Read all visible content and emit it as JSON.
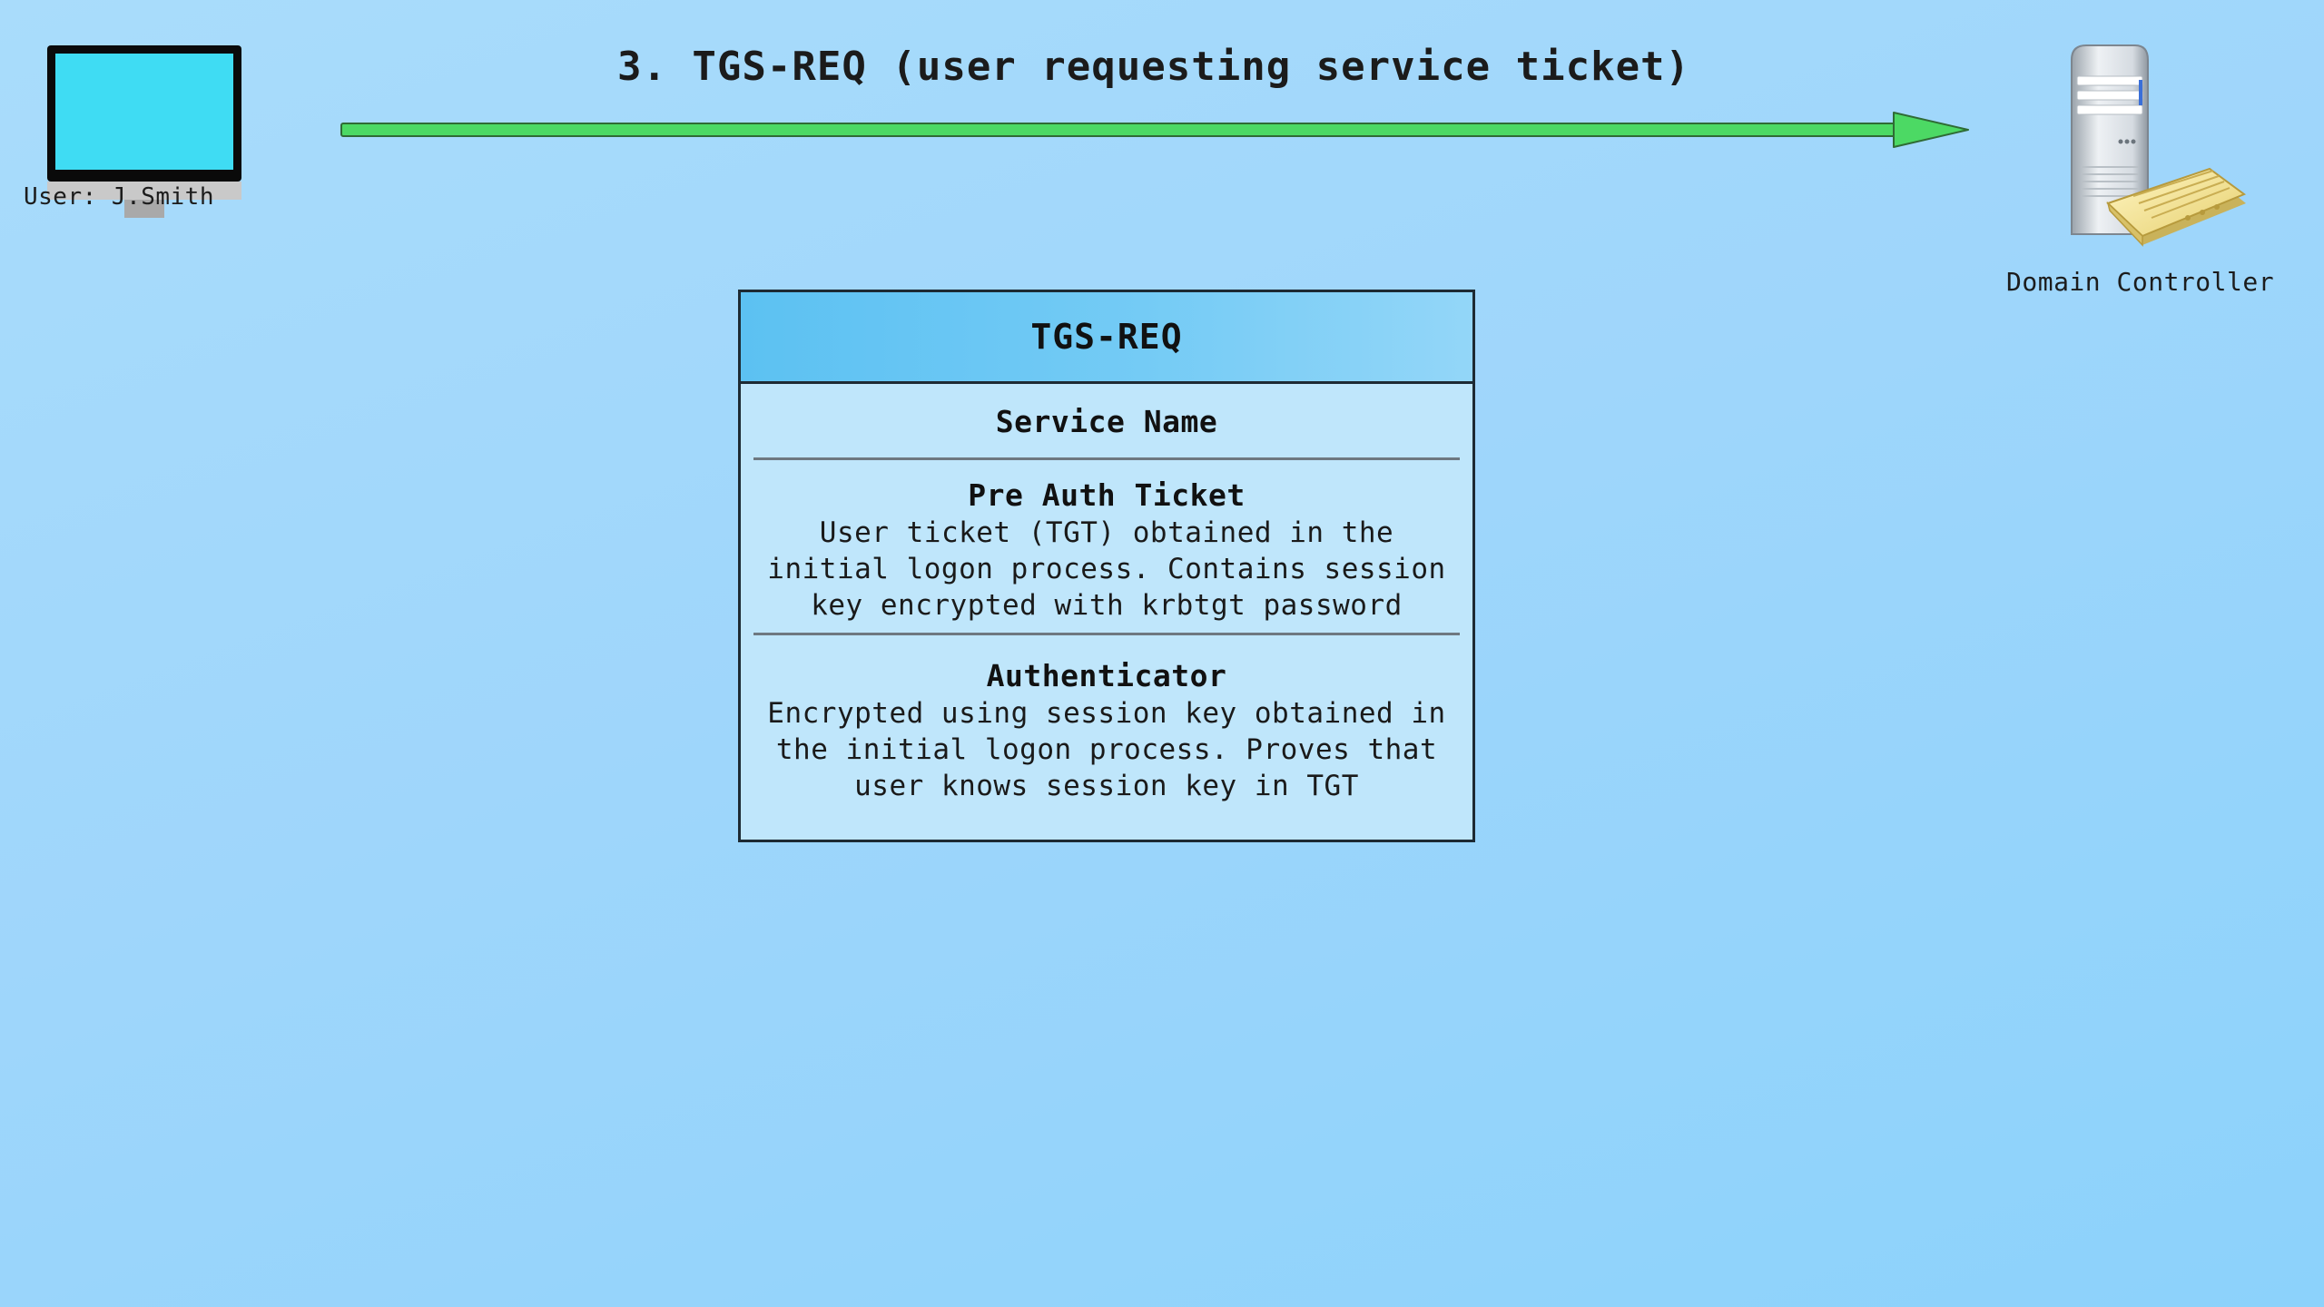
{
  "diagram": {
    "step_title": "3. TGS-REQ (user requesting service ticket)",
    "client": {
      "label": "User: J.Smith",
      "icon": "monitor-icon"
    },
    "server": {
      "label": "Domain Controller",
      "icon": "server-icon"
    },
    "arrow": {
      "direction": "right",
      "color": "#4cd964"
    },
    "packet": {
      "title": "TGS-REQ",
      "service_name": "Service Name",
      "pre_auth": {
        "title": "Pre Auth Ticket",
        "line1": "User ticket (TGT) obtained in the",
        "line2": "initial logon process. Contains session",
        "line3": "key encrypted with krbtgt password"
      },
      "authenticator": {
        "title": "Authenticator",
        "line1": "Encrypted using session key obtained in",
        "line2": "the initial logon process. Proves that",
        "line3": "user knows session key in TGT"
      }
    }
  },
  "colors": {
    "background": "#a6daf9",
    "monitor_screen": "#3fdcf3",
    "arrow": "#4cd964",
    "header": "#5cc1f2",
    "packet_body": "#bfe6fb"
  }
}
